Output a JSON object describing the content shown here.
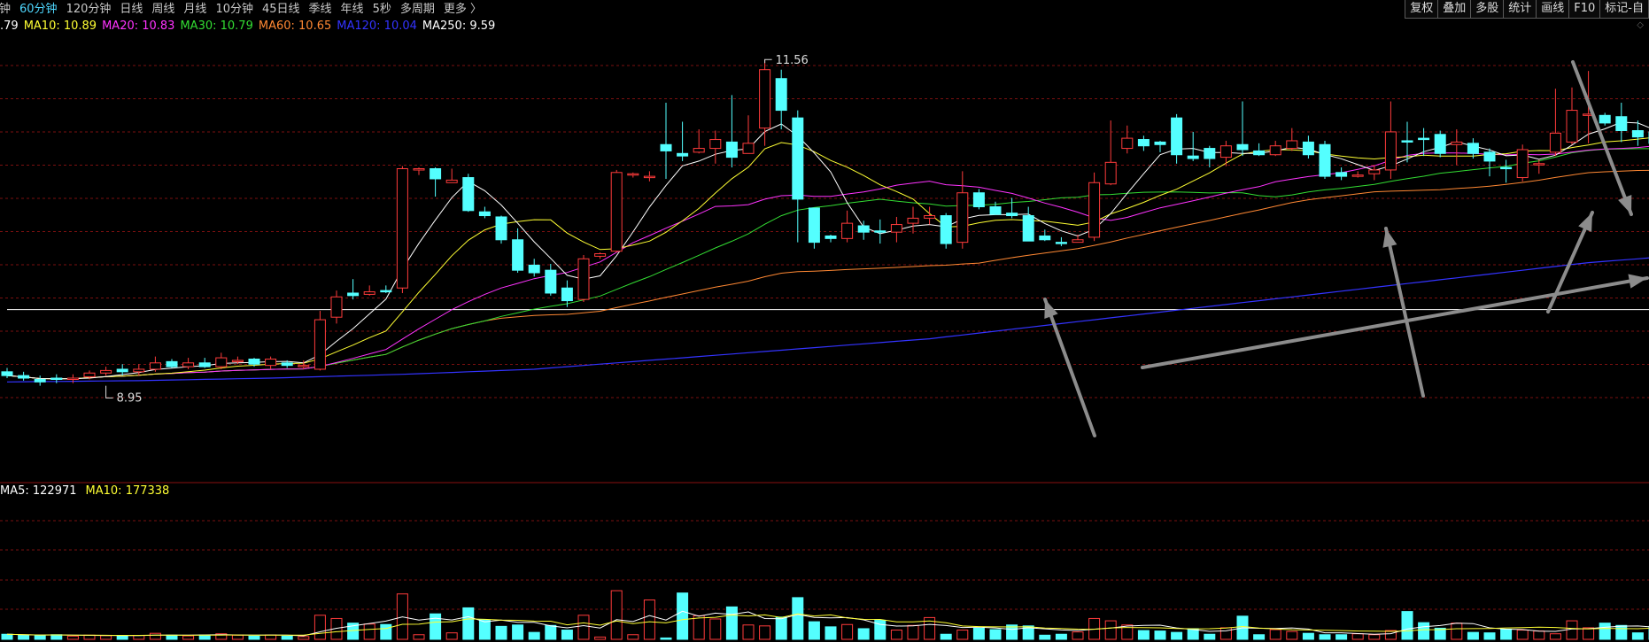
{
  "toolbar": {
    "periods": [
      "钟",
      "60分钟",
      "120分钟",
      "日线",
      "周线",
      "月线",
      "10分钟",
      "45日线",
      "季线",
      "年线",
      "5秒",
      "多周期",
      "更多 〉"
    ],
    "active_index": 1,
    "tools": [
      "复权",
      "叠加",
      "多股",
      "统计",
      "画线",
      "F10",
      "标记-自"
    ]
  },
  "ma_legend": [
    {
      "text": ".79",
      "color": "#ffffff"
    },
    {
      "text": "MA10: 10.89",
      "color": "#ffff33"
    },
    {
      "text": "MA20: 10.83",
      "color": "#ff33ff"
    },
    {
      "text": "MA30: 10.79",
      "color": "#33dd33"
    },
    {
      "text": "MA60: 10.65",
      "color": "#ff8833"
    },
    {
      "text": "MA120: 10.04",
      "color": "#3333ff"
    },
    {
      "text": "MA250: 9.59",
      "color": "#ffffff"
    }
  ],
  "vol_legend": [
    {
      "text": "MA5: 122971",
      "color": "#ffffff"
    },
    {
      "text": "MA10: 177338",
      "color": "#ffff33"
    }
  ],
  "annotations": {
    "high": "11.56",
    "low": "8.95"
  },
  "colors": {
    "up": "#ff3b3b",
    "down": "#54ffff",
    "grid": "#7a1010",
    "bg": "#000000"
  },
  "chart_data": {
    "type": "candlestick",
    "price_range": [
      8.75,
      11.75
    ],
    "candles": [
      [
        9.1,
        9.07,
        9.13,
        9.05
      ],
      [
        9.07,
        9.05,
        9.1,
        9.03
      ],
      [
        9.04,
        9.02,
        9.07,
        8.99
      ],
      [
        9.05,
        9.04,
        9.08,
        9.01
      ],
      [
        9.04,
        9.05,
        9.08,
        9.01
      ],
      [
        9.06,
        9.09,
        9.11,
        9.04
      ],
      [
        9.09,
        9.11,
        9.14,
        9.07
      ],
      [
        9.12,
        9.1,
        9.16,
        9.07
      ],
      [
        9.1,
        9.12,
        9.16,
        9.07
      ],
      [
        9.12,
        9.17,
        9.22,
        9.1
      ],
      [
        9.18,
        9.14,
        9.2,
        9.13
      ],
      [
        9.14,
        9.17,
        9.21,
        9.12
      ],
      [
        9.17,
        9.14,
        9.21,
        9.13
      ],
      [
        9.14,
        9.21,
        9.25,
        9.12
      ],
      [
        9.19,
        9.19,
        9.22,
        9.16
      ],
      [
        9.2,
        9.16,
        9.21,
        9.14
      ],
      [
        9.15,
        9.2,
        9.22,
        9.12
      ],
      [
        9.17,
        9.15,
        9.19,
        9.13
      ],
      [
        9.14,
        9.15,
        9.19,
        9.12
      ],
      [
        9.12,
        9.51,
        9.58,
        9.11
      ],
      [
        9.53,
        9.69,
        9.74,
        9.48
      ],
      [
        9.72,
        9.7,
        9.83,
        9.67
      ],
      [
        9.71,
        9.73,
        9.78,
        9.7
      ],
      [
        9.74,
        9.73,
        9.78,
        9.72
      ],
      [
        9.76,
        10.7,
        10.72,
        9.72
      ],
      [
        10.69,
        10.7,
        10.71,
        10.65
      ],
      [
        10.7,
        10.62,
        10.71,
        10.48
      ],
      [
        10.59,
        10.61,
        10.7,
        10.59
      ],
      [
        10.63,
        10.37,
        10.66,
        10.36
      ],
      [
        10.36,
        10.33,
        10.4,
        10.31
      ],
      [
        10.32,
        10.14,
        10.33,
        10.11
      ],
      [
        10.14,
        9.9,
        10.23,
        9.88
      ],
      [
        9.94,
        9.88,
        9.99,
        9.85
      ],
      [
        9.9,
        9.72,
        9.95,
        9.7
      ],
      [
        9.76,
        9.66,
        9.82,
        9.61
      ],
      [
        9.67,
        9.99,
        10.02,
        9.65
      ],
      [
        10.01,
        10.03,
        10.04,
        9.99
      ],
      [
        10.05,
        10.67,
        10.69,
        10.04
      ],
      [
        10.65,
        10.66,
        10.67,
        10.63
      ],
      [
        10.64,
        10.64,
        10.68,
        10.6
      ],
      [
        10.89,
        10.84,
        11.22,
        10.62
      ],
      [
        10.82,
        10.8,
        11.07,
        10.76
      ],
      [
        10.83,
        10.86,
        11.01,
        10.82
      ],
      [
        10.86,
        10.93,
        11.0,
        10.74
      ],
      [
        10.91,
        10.79,
        11.28,
        10.71
      ],
      [
        10.82,
        10.9,
        11.12,
        10.82
      ],
      [
        11.02,
        11.48,
        11.56,
        10.88
      ],
      [
        11.41,
        11.16,
        11.48,
        11.01
      ],
      [
        11.1,
        10.46,
        11.16,
        10.12
      ],
      [
        10.39,
        10.12,
        10.39,
        10.07
      ],
      [
        10.17,
        10.15,
        10.18,
        10.12
      ],
      [
        10.15,
        10.27,
        10.37,
        10.12
      ],
      [
        10.25,
        10.2,
        10.29,
        10.14
      ],
      [
        10.21,
        10.2,
        10.3,
        10.11
      ],
      [
        10.2,
        10.26,
        10.32,
        10.12
      ],
      [
        10.27,
        10.31,
        10.4,
        10.19
      ],
      [
        10.31,
        10.33,
        10.4,
        10.26
      ],
      [
        10.33,
        10.11,
        10.35,
        10.07
      ],
      [
        10.12,
        10.51,
        10.68,
        10.07
      ],
      [
        10.51,
        10.4,
        10.54,
        10.38
      ],
      [
        10.4,
        10.34,
        10.44,
        10.34
      ],
      [
        10.35,
        10.33,
        10.47,
        10.31
      ],
      [
        10.33,
        10.13,
        10.4,
        10.13
      ],
      [
        10.17,
        10.14,
        10.22,
        10.13
      ],
      [
        10.12,
        10.11,
        10.16,
        10.09
      ],
      [
        10.12,
        10.14,
        10.18,
        10.12
      ],
      [
        10.16,
        10.59,
        10.67,
        10.13
      ],
      [
        10.58,
        10.75,
        11.08,
        10.57
      ],
      [
        10.86,
        10.94,
        11.04,
        10.82
      ],
      [
        10.93,
        10.88,
        10.96,
        10.84
      ],
      [
        10.91,
        10.89,
        10.92,
        10.83
      ],
      [
        11.1,
        10.81,
        11.13,
        10.74
      ],
      [
        10.8,
        10.78,
        10.99,
        10.76
      ],
      [
        10.86,
        10.78,
        10.88,
        10.71
      ],
      [
        10.79,
        10.88,
        10.92,
        10.72
      ],
      [
        10.89,
        10.85,
        11.23,
        10.8
      ],
      [
        10.84,
        10.81,
        10.9,
        10.8
      ],
      [
        10.81,
        10.88,
        10.92,
        10.8
      ],
      [
        10.86,
        10.92,
        11.02,
        10.84
      ],
      [
        10.91,
        10.81,
        10.96,
        10.78
      ],
      [
        10.89,
        10.64,
        10.92,
        10.62
      ],
      [
        10.67,
        10.64,
        10.71,
        10.61
      ],
      [
        10.65,
        10.65,
        10.68,
        10.63
      ],
      [
        10.66,
        10.69,
        10.73,
        10.61
      ],
      [
        10.69,
        10.99,
        11.23,
        10.62
      ],
      [
        10.92,
        10.91,
        11.07,
        10.75
      ],
      [
        10.94,
        10.93,
        11.02,
        10.8
      ],
      [
        10.97,
        10.82,
        11.0,
        10.79
      ],
      [
        10.89,
        10.91,
        11.01,
        10.73
      ],
      [
        10.9,
        10.82,
        10.94,
        10.78
      ],
      [
        10.83,
        10.76,
        10.86,
        10.64
      ],
      [
        10.71,
        10.7,
        10.77,
        10.59
      ],
      [
        10.63,
        10.85,
        10.89,
        10.6
      ],
      [
        10.73,
        10.74,
        10.77,
        10.66
      ],
      [
        10.83,
        10.98,
        11.33,
        10.8
      ],
      [
        10.91,
        11.16,
        11.34,
        10.89
      ],
      [
        11.12,
        11.13,
        11.47,
        10.9
      ],
      [
        11.12,
        11.06,
        11.14,
        11.04
      ],
      [
        11.11,
        11.0,
        11.22,
        10.91
      ],
      [
        11.0,
        10.95,
        11.08,
        10.88
      ],
      [
        10.99,
        10.9,
        11.01,
        10.79
      ],
      [
        10.81,
        10.85,
        10.99,
        10.78
      ]
    ],
    "volume_range": [
      0,
      300000
    ],
    "volumes": [
      11000,
      9000,
      8000,
      10000,
      7000,
      9000,
      8000,
      7500,
      8500,
      13000,
      9000,
      7500,
      9500,
      12000,
      9000,
      7000,
      9500,
      7000,
      6000,
      52000,
      45000,
      35000,
      33000,
      32000,
      98000,
      10000,
      55000,
      14000,
      68000,
      42000,
      28000,
      31000,
      15000,
      30000,
      20000,
      52000,
      5000,
      105000,
      10000,
      85000,
      3000,
      100000,
      51000,
      44000,
      70000,
      31000,
      29000,
      48000,
      90000,
      38000,
      27000,
      32000,
      23000,
      41000,
      20000,
      30000,
      47000,
      11000,
      20000,
      24000,
      21000,
      31000,
      29000,
      9000,
      11000,
      16000,
      45000,
      40000,
      31000,
      19000,
      18000,
      15000,
      23000,
      11000,
      25000,
      50000,
      10000,
      21000,
      17000,
      13000,
      10000,
      10000,
      12000,
      10000,
      19000,
      60000,
      36000,
      24000,
      35000,
      15000,
      14000,
      22000,
      20000,
      18000,
      12000,
      40000,
      25000,
      35000,
      30000,
      14000,
      28000,
      13000
    ]
  }
}
